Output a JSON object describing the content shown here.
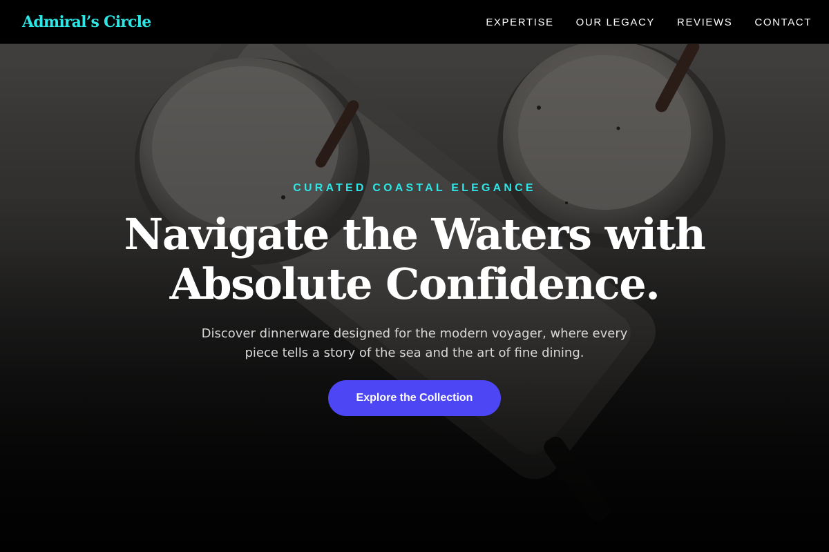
{
  "brand": {
    "name": "Admiral’s Circle"
  },
  "nav": {
    "items": [
      {
        "label": "EXPERTISE"
      },
      {
        "label": "OUR LEGACY"
      },
      {
        "label": "REVIEWS"
      },
      {
        "label": "CONTACT"
      }
    ]
  },
  "hero": {
    "eyebrow": "CURATED COASTAL ELEGANCE",
    "headline_line1": "Navigate the Waters with",
    "headline_line2": "Absolute Confidence.",
    "subtext_line1": "Discover dinnerware designed for the modern voyager, where every",
    "subtext_line2": "piece tells a story of the sea and the art of fine dining.",
    "cta_label": "Explore the Collection",
    "background_image": "ceramic-tableware-photo"
  },
  "colors": {
    "accent": "#2ee6e6",
    "button": "#4d46f5",
    "nav_background": "#000000",
    "text": "#ffffff"
  }
}
